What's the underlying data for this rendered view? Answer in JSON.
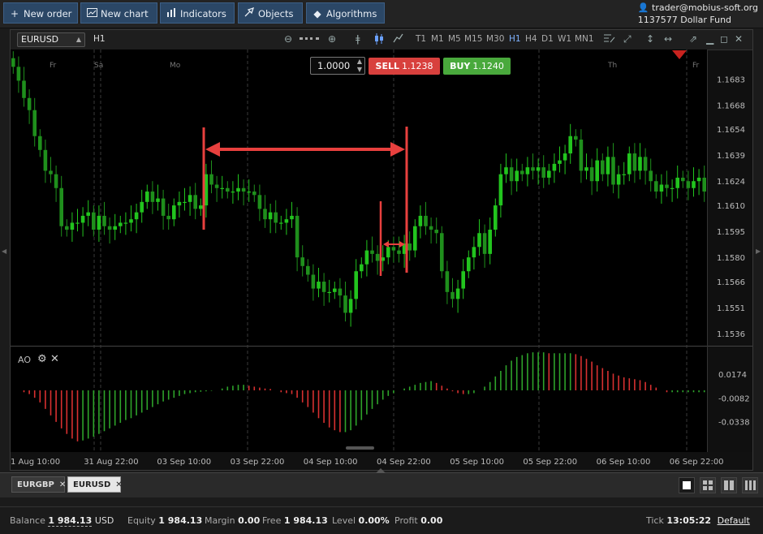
{
  "toolbar": {
    "new_order": "New order",
    "new_chart": "New chart",
    "indicators": "Indicators",
    "objects": "Objects",
    "algorithms": "Algorithms"
  },
  "account": {
    "email": "trader@mobius-soft.org",
    "number": "1137577",
    "fund": "Dollar Fund"
  },
  "chart": {
    "symbol": "EURUSD",
    "timeframe": "H1",
    "timeframes": [
      "T1",
      "M1",
      "M5",
      "M15",
      "M30",
      "H1",
      "H4",
      "D1",
      "W1",
      "MN1"
    ],
    "active_timeframe": "H1",
    "quantity": "1.0000",
    "sell_label": "SELL",
    "sell_price": "1.1238",
    "buy_label": "BUY",
    "buy_price": "1.1240",
    "day_labels": [
      "Fr",
      "Sa",
      "Mo",
      "Th",
      "Fr"
    ]
  },
  "chart_data": {
    "type": "candlestick",
    "price_axis": [
      "1.1683",
      "1.1668",
      "1.1654",
      "1.1639",
      "1.1624",
      "1.1610",
      "1.1595",
      "1.1580",
      "1.1566",
      "1.1551",
      "1.1536"
    ],
    "ylim": [
      1.1529,
      1.17
    ],
    "time_labels": [
      "1 Aug 10:00",
      "31 Aug 22:00",
      "03 Sep 10:00",
      "03 Sep 22:00",
      "04 Sep 10:00",
      "04 Sep 22:00",
      "05 Sep 10:00",
      "05 Sep 22:00",
      "06 Sep 10:00",
      "06 Sep 22:00"
    ],
    "closes": [
      1.169,
      1.1682,
      1.1672,
      1.1665,
      1.165,
      1.1642,
      1.163,
      1.1628,
      1.162,
      1.1598,
      1.1596,
      1.16,
      1.16,
      1.1604,
      1.1606,
      1.1596,
      1.1604,
      1.1598,
      1.1596,
      1.1598,
      1.16,
      1.16,
      1.1602,
      1.1606,
      1.1612,
      1.1618,
      1.1612,
      1.1614,
      1.1604,
      1.1602,
      1.161,
      1.1612,
      1.1612,
      1.1616,
      1.1608,
      1.161,
      1.1628,
      1.1622,
      1.162,
      1.162,
      1.1618,
      1.1618,
      1.162,
      1.1618,
      1.1618,
      1.1616,
      1.1608,
      1.1602,
      1.1606,
      1.16,
      1.16,
      1.1602,
      1.1604,
      1.158,
      1.1575,
      1.157,
      1.1562,
      1.1566,
      1.156,
      1.156,
      1.1562,
      1.1558,
      1.1548,
      1.1556,
      1.1572,
      1.1576,
      1.1584,
      1.1582,
      1.1578,
      1.158,
      1.1586,
      1.1584,
      1.1582,
      1.1588,
      1.1584,
      1.1598,
      1.1604,
      1.1598,
      1.1596,
      1.1594,
      1.1572,
      1.156,
      1.1556,
      1.1562,
      1.1572,
      1.158,
      1.1586,
      1.1594,
      1.1582,
      1.1596,
      1.161,
      1.1628,
      1.1632,
      1.1624,
      1.163,
      1.1628,
      1.1632,
      1.163,
      1.1632,
      1.1626,
      1.163,
      1.1634,
      1.1636,
      1.164,
      1.165,
      1.1648,
      1.163,
      1.1632,
      1.1624,
      1.1636,
      1.1628,
      1.1638,
      1.1622,
      1.1628,
      1.1628,
      1.164,
      1.163,
      1.1638,
      1.163,
      1.1624,
      1.1618,
      1.1622,
      1.162,
      1.162,
      1.1626,
      1.1624,
      1.162,
      1.1624,
      1.1626,
      1.1618
    ],
    "ao": {
      "name": "AO",
      "axis": [
        "0.0174",
        "-0.0082",
        "-0.0338"
      ],
      "values": [
        0,
        0,
        -0.002,
        -0.004,
        -0.008,
        -0.013,
        -0.02,
        -0.027,
        -0.034,
        -0.041,
        -0.047,
        -0.052,
        -0.055,
        -0.054,
        -0.052,
        -0.05,
        -0.047,
        -0.044,
        -0.041,
        -0.038,
        -0.035,
        -0.032,
        -0.03,
        -0.027,
        -0.024,
        -0.021,
        -0.018,
        -0.015,
        -0.012,
        -0.01,
        -0.008,
        -0.006,
        -0.004,
        -0.003,
        -0.002,
        -0.0015,
        -0.001,
        -0.0005,
        0,
        0.002,
        0.004,
        0.005,
        0.006,
        0.006,
        0.005,
        0.004,
        0.003,
        0.002,
        0.0015,
        0,
        -0.002,
        -0.003,
        -0.004,
        -0.008,
        -0.013,
        -0.018,
        -0.024,
        -0.03,
        -0.035,
        -0.04,
        -0.043,
        -0.045,
        -0.045,
        -0.043,
        -0.038,
        -0.032,
        -0.026,
        -0.02,
        -0.015,
        -0.01,
        -0.006,
        -0.003,
        0,
        0.002,
        0.004,
        0.006,
        0.008,
        0.009,
        0.01,
        0.008,
        0.005,
        0.002,
        -0.001,
        -0.003,
        -0.004,
        -0.004,
        -0.003,
        0,
        0.004,
        0.009,
        0.015,
        0.021,
        0.027,
        0.032,
        0.036,
        0.038,
        0.04,
        0.041,
        0.041,
        0.041,
        0.04,
        0.04,
        0.04,
        0.04,
        0.04,
        0.039,
        0.037,
        0.034,
        0.031,
        0.027,
        0.024,
        0.021,
        0.018,
        0.016,
        0.014,
        0.013,
        0.012,
        0.011,
        0.009,
        0.006,
        0.003,
        0,
        -0.002,
        -0.002,
        -0.002,
        -0.002,
        -0.002,
        -0.002,
        -0.002,
        -0.002
      ]
    }
  },
  "tabs": [
    {
      "label": "EURGBP",
      "close": "✕"
    },
    {
      "label": "EURUSD",
      "close": "✕"
    }
  ],
  "status": {
    "balance_label": "Balance",
    "balance": "1 984.13",
    "currency": "USD",
    "equity_label": "Equity",
    "equity": "1 984.13",
    "margin_label": "Margin",
    "margin": "0.00",
    "free_label": "Free",
    "free": "1 984.13",
    "level_label": "Level",
    "level": "0.00%",
    "profit_label": "Profit",
    "profit": "0.00",
    "tick_label": "Tick",
    "tick_time": "13:05:22",
    "default_label": "Default"
  },
  "colors": {
    "up": "#22c41e",
    "down": "#1f8f1c",
    "ao_up": "#2ea32a",
    "ao_down": "#d83030",
    "annotation": "#e8403e"
  }
}
